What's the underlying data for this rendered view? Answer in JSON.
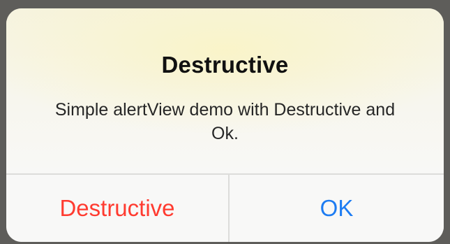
{
  "alert": {
    "title": "Destructive",
    "message": "Simple alertView demo with Destructive and Ok.",
    "buttons": [
      {
        "label": "Destructive",
        "style": "destructive",
        "color": "#ff3b30"
      },
      {
        "label": "OK",
        "style": "default",
        "color": "#1d7cf2"
      }
    ]
  }
}
